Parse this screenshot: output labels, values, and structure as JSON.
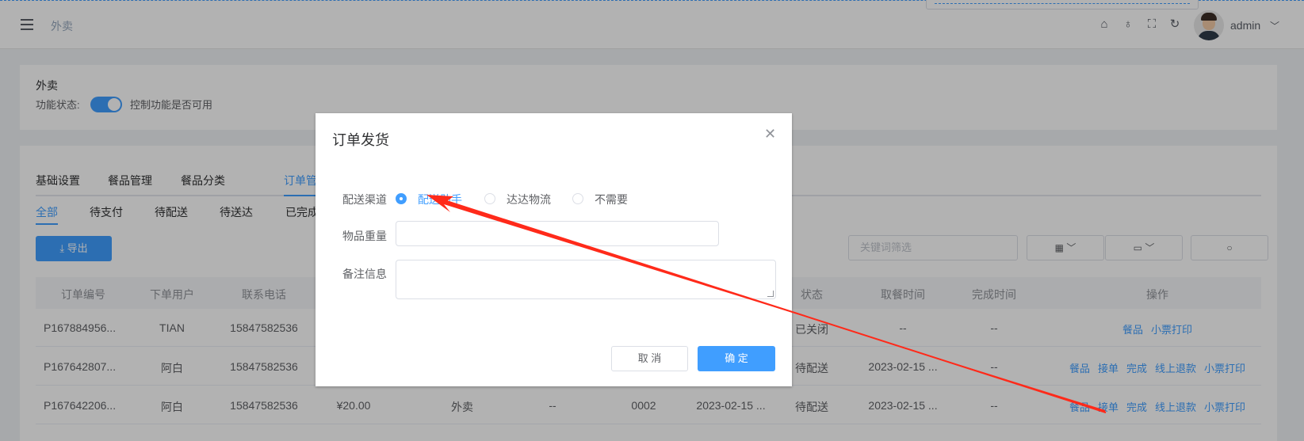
{
  "header": {
    "breadcrumb": "外卖",
    "username": "admin",
    "icons": [
      "menu-fold-icon",
      "brush-icon",
      "shirt-icon",
      "fullscreen-icon",
      "refresh-icon",
      "chevron-down-icon"
    ]
  },
  "module": {
    "title": "外卖",
    "status_label": "功能状态:",
    "status_on": true,
    "status_desc": "控制功能是否可用"
  },
  "tabs": [
    "基础设置",
    "餐品管理",
    "餐品分类",
    "订单管理"
  ],
  "active_tab": "订单管理",
  "subtabs": [
    "全部",
    "待支付",
    "待配送",
    "待送达",
    "已完成"
  ],
  "active_subtab": "全部",
  "toolbar": {
    "export_label": "导出",
    "filter_placeholder": "关键词筛选"
  },
  "table": {
    "columns": [
      "订单编号",
      "下单用户",
      "联系电话",
      "状态",
      "取餐时间",
      "完成时间",
      "操作"
    ],
    "rows": [
      {
        "order_no": "P167884956...",
        "user": "TIAN",
        "phone": "15847582536",
        "amount": "",
        "type": "",
        "note": "",
        "pickup_no": "",
        "created": "",
        "status": "已关闭",
        "pickup_time": "--",
        "done_time": "--",
        "actions": [
          "餐品",
          "小票打印"
        ]
      },
      {
        "order_no": "P167642807...",
        "user": "阿白",
        "phone": "15847582536",
        "amount": "",
        "type": "",
        "note": "",
        "pickup_no": "",
        "created": "",
        "status": "待配送",
        "pickup_time": "2023-02-15 ...",
        "done_time": "--",
        "actions": [
          "餐品",
          "接单",
          "完成",
          "线上退款",
          "小票打印"
        ]
      },
      {
        "order_no": "P167642206...",
        "user": "阿白",
        "phone": "15847582536",
        "amount": "¥20.00",
        "type": "外卖",
        "note": "--",
        "pickup_no": "0002",
        "created": "2023-02-15 ...",
        "status": "待配送",
        "pickup_time": "2023-02-15 ...",
        "done_time": "--",
        "actions": [
          "餐品",
          "接单",
          "完成",
          "线上退款",
          "小票打印"
        ]
      }
    ]
  },
  "dialog": {
    "title": "订单发货",
    "channel_label": "配送渠道",
    "channel_options": [
      "配送助手",
      "达达物流",
      "不需要"
    ],
    "channel_selected": "配送助手",
    "weight_label": "物品重量",
    "weight_value": "",
    "remark_label": "备注信息",
    "remark_value": "",
    "cancel_label": "取 消",
    "ok_label": "确 定"
  },
  "annotation_color": "#ff2a1a"
}
